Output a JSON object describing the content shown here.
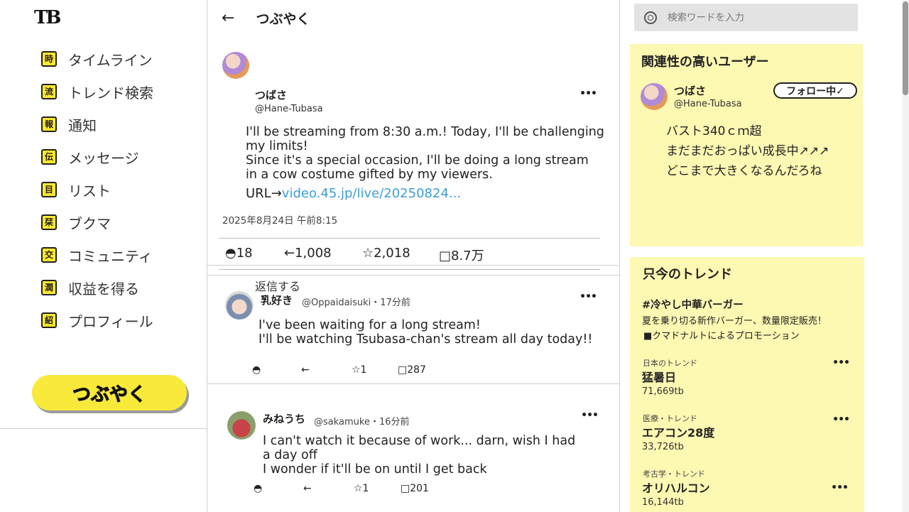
{
  "brand": {
    "logo": "TB",
    "accent_color": "#f8e93a",
    "card_color": "#fdf8b2",
    "link_color": "#3c9ed8"
  },
  "nav": {
    "items": [
      {
        "icon": "時",
        "label": "タイムライン"
      },
      {
        "icon": "流",
        "label": "トレンド検索"
      },
      {
        "icon": "報",
        "label": "通知"
      },
      {
        "icon": "伝",
        "label": "メッセージ"
      },
      {
        "icon": "目",
        "label": "リスト"
      },
      {
        "icon": "栞",
        "label": "ブクマ"
      },
      {
        "icon": "交",
        "label": "コミュニティ"
      },
      {
        "icon": "潤",
        "label": "収益を得る"
      },
      {
        "icon": "紹",
        "label": "プロフィール"
      }
    ],
    "post_button": "つぶやく"
  },
  "center": {
    "back": "←",
    "title": "つぶやく",
    "post": {
      "author": "つばさ",
      "handle": "@Hane-Tubasa",
      "more": "•••",
      "body": [
        "I'll be streaming from 8:30 a.m.! Today, I'll be challenging",
        "my limits!",
        "Since it's a special occasion, I'll be doing a long stream",
        "in a cow costume gifted by my viewers."
      ],
      "url_prefix": "URL→",
      "url": "video.45.jp/live/20250824...",
      "timestamp": "2025年8月24日 午前8:15",
      "stats": {
        "replies": "◓18",
        "reposts": "←1,008",
        "likes": "☆2,018",
        "views": "□8.7万"
      },
      "reply_link": "返信する"
    },
    "replies": [
      {
        "author": "乳好き",
        "meta": "@Oppaidaisuki・17分前",
        "more": "•••",
        "body": [
          "I've been waiting for a long stream!",
          "I'll be watching Tsubasa-chan's stream all day today!!"
        ],
        "actions": {
          "reply": "◓",
          "repost": "←",
          "like": "☆1",
          "views": "□287"
        }
      },
      {
        "author": "みねうち",
        "meta": "@sakamuke・16分前",
        "more": "•••",
        "body": [
          "I can't watch it because of work... darn, wish I had",
          "a day off",
          "I wonder if it'll be on until I get back"
        ],
        "actions": {
          "reply": "◓",
          "repost": "←",
          "like": "☆1",
          "views": "□201"
        }
      }
    ]
  },
  "right": {
    "search": {
      "placeholder": "検索ワードを入力"
    },
    "related": {
      "title": "関連性の高いユーザー",
      "user": {
        "name": "つばさ",
        "handle": "@Hane-Tubasa",
        "follow_label": "フォロー中✓"
      },
      "bio": [
        "バスト340ｃｍ超",
        "まだまだおっぱい成長中↗↗↗",
        "どこまで大きくなるんだろね"
      ]
    },
    "trends": {
      "title": "只今のトレンド",
      "promoted": {
        "tag": "#冷やし中華バーガー",
        "desc": "夏を乗り切る新作バーガー、数量限定販売！",
        "promo": "■クマドナルトによるプロモーション"
      },
      "items": [
        {
          "category": "日本のトレンド",
          "name": "猛暑日",
          "count": "71,669tb"
        },
        {
          "category": "医療・トレンド",
          "name": "エアコン28度",
          "count": "33,726tb"
        },
        {
          "category": "考古学・トレンド",
          "name": "オリハルコン",
          "count": "16,144tb"
        }
      ],
      "more": "•••"
    }
  }
}
